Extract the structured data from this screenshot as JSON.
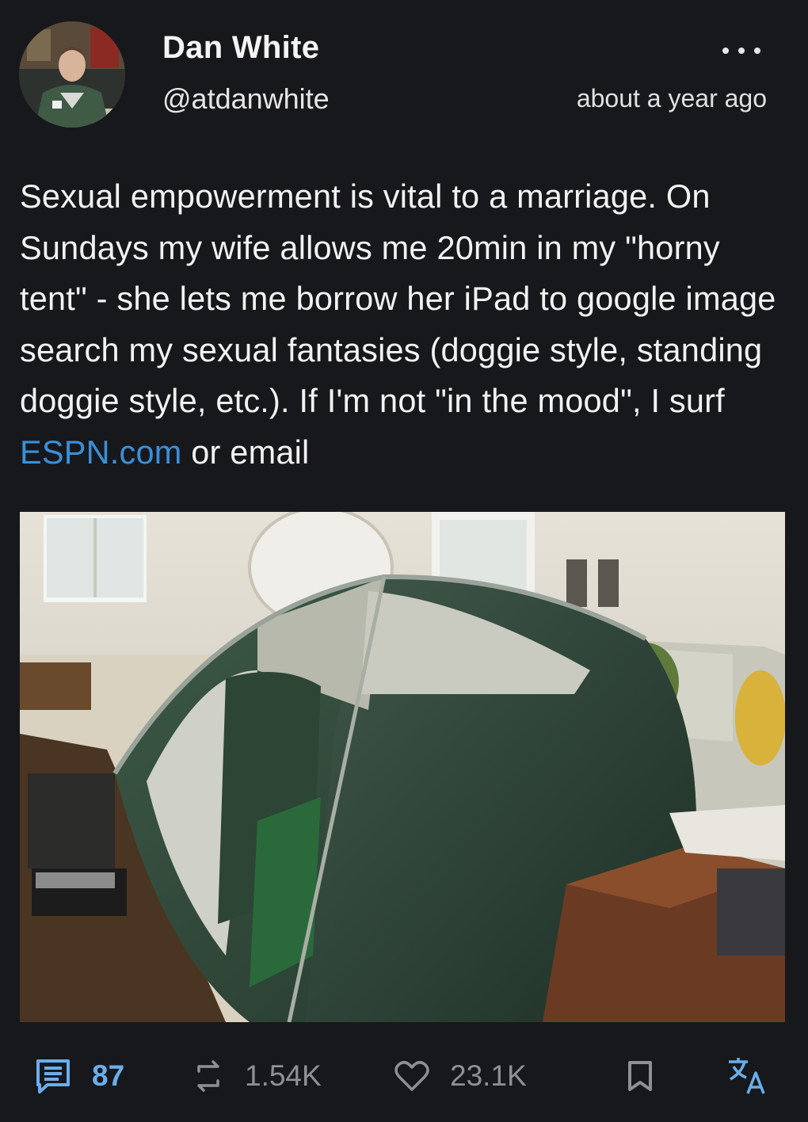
{
  "author": {
    "name": "Dan White",
    "handle": "@atdanwhite",
    "avatar_icon": "profile-photo"
  },
  "post": {
    "timestamp": "about a year ago",
    "text_before_link": "Sexual empowerment is vital to a marriage. On Sundays my wife allows me 20min in my \"horny tent\" - she lets me borrow her iPad to google image search my sexual fantasies (doggie style, standing doggie style, etc.). If I'm not \"in the mood\", I surf ",
    "link_text": "ESPN.com",
    "text_after_link": " or email",
    "image_icon": "photo-of-tent-in-living-room"
  },
  "actions": {
    "replies": "87",
    "reposts": "1.54K",
    "likes": "23.1K"
  },
  "colors": {
    "background": "#17181c",
    "link": "#3a8fd8",
    "accent": "#6aaeea",
    "muted": "#8e9096"
  }
}
